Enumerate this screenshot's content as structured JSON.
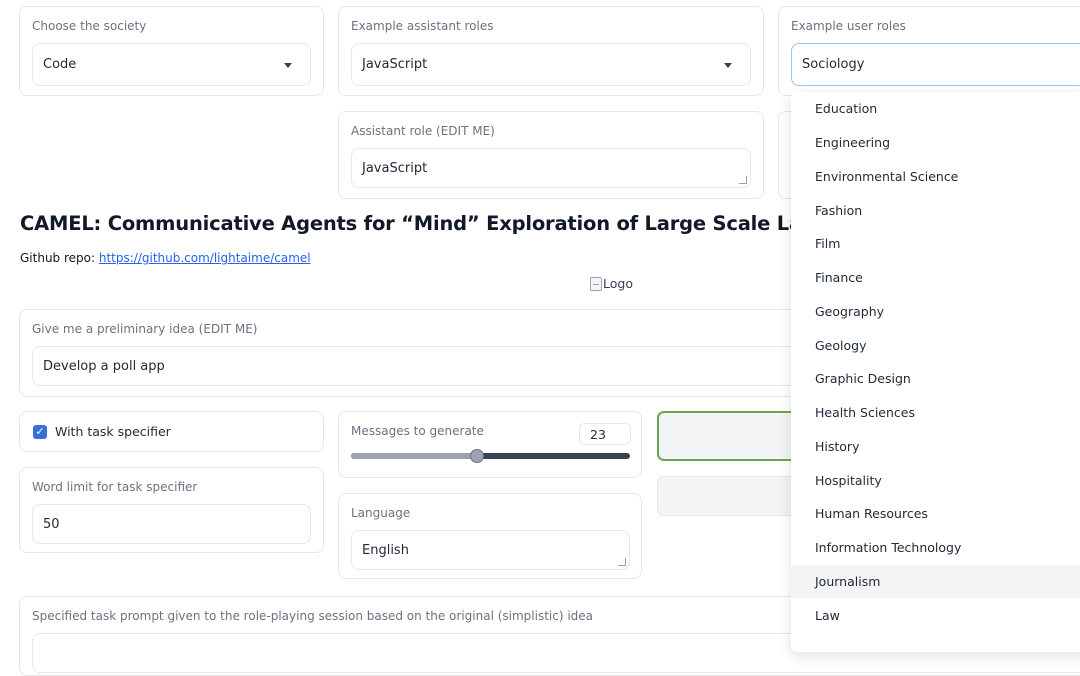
{
  "society": {
    "label": "Choose the society",
    "value": "Code"
  },
  "assistant_roles": {
    "label": "Example assistant roles",
    "value": "JavaScript"
  },
  "user_roles": {
    "label": "Example user roles",
    "value": "Sociology",
    "options": [
      "Education",
      "Engineering",
      "Environmental Science",
      "Fashion",
      "Film",
      "Finance",
      "Geography",
      "Geology",
      "Graphic Design",
      "Health Sciences",
      "History",
      "Hospitality",
      "Human Resources",
      "Information Technology",
      "Journalism",
      "Law"
    ],
    "highlighted": "Journalism"
  },
  "assistant_role": {
    "label": "Assistant role (EDIT ME)",
    "value": "JavaScript"
  },
  "heading": {
    "title": "CAMEL: Communicative Agents for “Mind” Exploration of Large Scale Language Model S",
    "repo_prefix": "Github repo: ",
    "repo_link": "https://github.com/lightaime/camel"
  },
  "logo": {
    "alt": "Logo"
  },
  "idea": {
    "label": "Give me a preliminary idea (EDIT ME)",
    "value": "Develop a poll app"
  },
  "task_specifier": {
    "label": "With task specifier",
    "checked": true
  },
  "messages": {
    "label": "Messages to generate",
    "value": "23",
    "fraction": 0.45
  },
  "word_limit": {
    "label": "Word limit for task specifier",
    "value": "50"
  },
  "language": {
    "label": "Language",
    "value": "English"
  },
  "specified_task": {
    "label": "Specified task prompt given to the role-playing session based on the original (simplistic) idea"
  },
  "colors": {
    "accent": "#3b6fd8",
    "link": "#2563eb",
    "active_border": "#6aa84f"
  },
  "icons": {
    "dropdown": "chevron-down-icon",
    "checkbox": "checkmark-icon",
    "logo": "broken-image-icon"
  }
}
